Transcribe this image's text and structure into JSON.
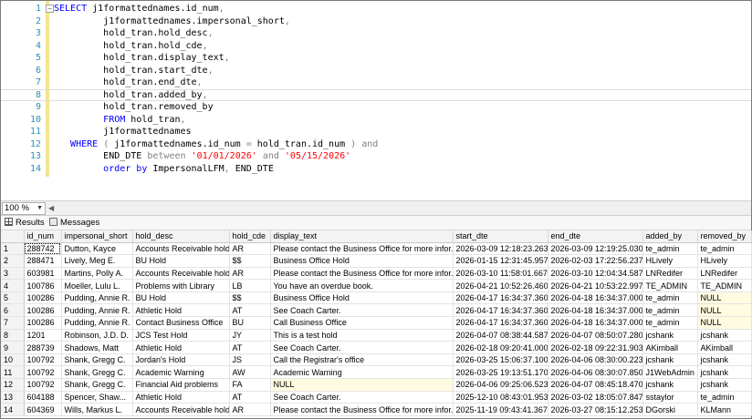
{
  "editor": {
    "lines": [
      {
        "num": "1",
        "tokens": [
          [
            "kw",
            "SELECT "
          ],
          [
            "plain",
            "j1formattednames.id_num"
          ],
          [
            "gray",
            ","
          ]
        ]
      },
      {
        "num": "2",
        "tokens": [
          [
            "plain",
            "         j1formattednames.impersonal_short"
          ],
          [
            "gray",
            ","
          ]
        ]
      },
      {
        "num": "3",
        "tokens": [
          [
            "plain",
            "         hold_tran.hold_desc"
          ],
          [
            "gray",
            ","
          ]
        ]
      },
      {
        "num": "4",
        "tokens": [
          [
            "plain",
            "         hold_tran.hold_cde"
          ],
          [
            "gray",
            ","
          ]
        ]
      },
      {
        "num": "5",
        "tokens": [
          [
            "plain",
            "         hold_tran.display_text"
          ],
          [
            "gray",
            ","
          ]
        ]
      },
      {
        "num": "6",
        "tokens": [
          [
            "plain",
            "         hold_tran.start_dte"
          ],
          [
            "gray",
            ","
          ]
        ]
      },
      {
        "num": "7",
        "tokens": [
          [
            "plain",
            "         hold_tran.end_dte"
          ],
          [
            "gray",
            ","
          ]
        ]
      },
      {
        "num": "8",
        "tokens": [
          [
            "plain",
            "         hold_tran.added_by"
          ],
          [
            "gray",
            ","
          ]
        ]
      },
      {
        "num": "9",
        "tokens": [
          [
            "plain",
            "         hold_tran.removed_by"
          ]
        ]
      },
      {
        "num": "10",
        "tokens": [
          [
            "kw",
            "         FROM "
          ],
          [
            "plain",
            "hold_tran"
          ],
          [
            "gray",
            ","
          ]
        ]
      },
      {
        "num": "11",
        "tokens": [
          [
            "plain",
            "         j1formattednames"
          ]
        ]
      },
      {
        "num": "12",
        "tokens": [
          [
            "kw",
            "   WHERE "
          ],
          [
            "gray",
            "( "
          ],
          [
            "plain",
            "j1formattednames.id_num "
          ],
          [
            "gray",
            "= "
          ],
          [
            "plain",
            "hold_tran.id_num "
          ],
          [
            "gray",
            ") "
          ],
          [
            "gray",
            "and"
          ]
        ]
      },
      {
        "num": "13",
        "tokens": [
          [
            "plain",
            "         END_DTE "
          ],
          [
            "gray",
            "between "
          ],
          [
            "str",
            "'01/01/2026' "
          ],
          [
            "gray",
            "and "
          ],
          [
            "str",
            "'05/15/2026'"
          ]
        ]
      },
      {
        "num": "14",
        "tokens": [
          [
            "kw",
            "         order by "
          ],
          [
            "plain",
            "ImpersonalLFM"
          ],
          [
            "gray",
            ", "
          ],
          [
            "plain",
            "END_DTE"
          ]
        ]
      }
    ]
  },
  "zoom": {
    "value": "100 %"
  },
  "tabs": {
    "results": "Results",
    "messages": "Messages"
  },
  "grid": {
    "columns": [
      "id_num",
      "impersonal_short",
      "hold_desc",
      "hold_cde",
      "display_text",
      "start_dte",
      "end_dte",
      "added_by",
      "removed_by"
    ],
    "rows": [
      [
        "288742",
        "Dutton, Kayce",
        "Accounts Receivable hold",
        "AR",
        "Please contact the Business Office for more infor...",
        "2026-03-09 12:18:23.263",
        "2026-03-09 12:19:25.030",
        "te_admin",
        "te_admin"
      ],
      [
        "288471",
        "Lively, Meg E.",
        "BU Hold",
        "$$",
        "Business Office Hold",
        "2026-01-15 12:31:45.957",
        "2026-02-03 17:22:56.237",
        "HLively",
        "HLively"
      ],
      [
        "603981",
        "Martins, Polly A.",
        "Accounts Receivable hold",
        "AR",
        "Please contact the Business Office for more infor...",
        "2026-03-10 11:58:01.667",
        "2026-03-10 12:04:34.587",
        "LNRedifer",
        "LNRedifer"
      ],
      [
        "100786",
        "Moeller, Lulu L.",
        "Problems with Library",
        "LB",
        "You have an overdue book.",
        "2026-04-21 10:52:26.460",
        "2026-04-21 10:53:22.997",
        "TE_ADMIN",
        "TE_ADMIN"
      ],
      [
        "100286",
        "Pudding, Annie R.",
        "BU Hold",
        "$$",
        "Business Office Hold",
        "2026-04-17 16:34:37.360",
        "2026-04-18 16:34:37.000",
        "te_admin",
        "NULL"
      ],
      [
        "100286",
        "Pudding, Annie R.",
        "Athletic Hold",
        "AT",
        "See Coach Carter.",
        "2026-04-17 16:34:37.360",
        "2026-04-18 16:34:37.000",
        "te_admin",
        "NULL"
      ],
      [
        "100286",
        "Pudding, Annie R.",
        "Contact Business Office",
        "BU",
        "Call Business Office",
        "2026-04-17 16:34:37.360",
        "2026-04-18 16:34:37.000",
        "te_admin",
        "NULL"
      ],
      [
        "1201",
        "Robinson, J.D. D.",
        "JCS Test Hold",
        "JY",
        "This is a test hold",
        "2026-04-07 08:38:44.587",
        "2026-04-07 08:50:07.280",
        "jcshank",
        "jcshank"
      ],
      [
        "288739",
        "Shadows, Matt",
        "Athletic Hold",
        "AT",
        "See Coach Carter.",
        "2026-02-18 09:20:41.000",
        "2026-02-18 09:22:31.903",
        "AKimball",
        "AKimball"
      ],
      [
        "100792",
        "Shank, Gregg C.",
        "Jordan's Hold",
        "JS",
        "Call the Registrar's office",
        "2026-03-25 15:06:37.100",
        "2026-04-06 08:30:00.223",
        "jcshank",
        "jcshank"
      ],
      [
        "100792",
        "Shank, Gregg C.",
        "Academic Warning",
        "AW",
        "Academic Warning",
        "2026-03-25 19:13:51.170",
        "2026-04-06 08:30:07.850",
        "J1WebAdmin",
        "jcshank"
      ],
      [
        "100792",
        "Shank, Gregg C.",
        "Financial Aid problems",
        "FA",
        "NULL",
        "2026-04-06 09:25:06.523",
        "2026-04-07 08:45:18.470",
        "jcshank",
        "jcshank"
      ],
      [
        "604188",
        "Spencer, Shaw...",
        "Athletic Hold",
        "AT",
        "See Coach Carter.",
        "2025-12-10 08:43:01.953",
        "2026-03-02 18:05:07.847",
        "sstaylor",
        "te_admin"
      ],
      [
        "604369",
        "Wills, Markus L.",
        "Accounts Receivable hold",
        "AR",
        "Please contact the Business Office for more infor...",
        "2025-11-19 09:43:41.367",
        "2026-03-27 08:15:12.253",
        "DGorski",
        "KLMann"
      ]
    ]
  }
}
